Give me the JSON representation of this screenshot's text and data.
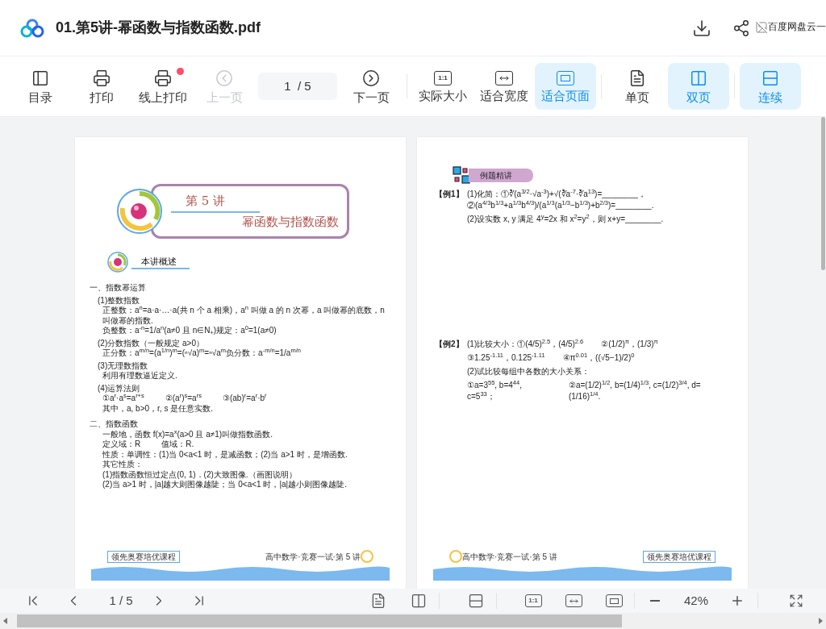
{
  "header": {
    "title": "01.第5讲-幂函数与指数函数.pdf",
    "image_alt": "百度网盘云一"
  },
  "toolbar": [
    [
      {
        "kind": "button",
        "label": "目录",
        "selected": false,
        "disabled": false,
        "notification": false
      },
      {
        "kind": "button",
        "label": "打印",
        "selected": false,
        "disabled": false,
        "notification": false
      },
      {
        "kind": "button",
        "label": "线上打印",
        "selected": false,
        "disabled": false,
        "notification": true
      },
      {
        "kind": "button",
        "label": "上一页",
        "selected": false,
        "disabled": true,
        "notification": false
      },
      {
        "kind": "page_field",
        "value": "1  / 5"
      },
      {
        "kind": "button",
        "label": "下一页",
        "selected": false,
        "disabled": false,
        "notification": false
      }
    ],
    [
      {
        "kind": "button",
        "label": "实际大小",
        "icon_text": "1:1",
        "selected": false,
        "disabled": false,
        "notification": false
      },
      {
        "kind": "button",
        "label": "适合宽度",
        "selected": false,
        "disabled": false,
        "notification": false
      },
      {
        "kind": "button",
        "label": "适合页面",
        "selected": true,
        "disabled": false,
        "notification": false
      }
    ],
    [
      {
        "kind": "button",
        "label": "单页",
        "selected": false,
        "disabled": false,
        "notification": false
      },
      {
        "kind": "button",
        "label": "双页",
        "selected": true,
        "disabled": false,
        "notification": false
      }
    ],
    [
      {
        "kind": "button",
        "label": "连续",
        "selected": true,
        "disabled": false,
        "notification": false
      }
    ]
  ],
  "left_page": {
    "lecture": "第 5 讲",
    "title": "幂函数与指数函数",
    "section": "本讲概述",
    "blocks": [
      {
        "kind": "h1",
        "text": "一、指数幂运算"
      },
      {
        "kind": "sub",
        "text": "(1)整数指数"
      },
      {
        "kind": "p",
        "text": "正整数：a$^{n}$=a·a·…·a(共 n 个 a 相乘)，a$^{n}$ 叫做 a 的 n 次幂，a 叫做幂的底数，n 叫做幂的指数."
      },
      {
        "kind": "p",
        "text": "负整数：a$^{-n}$=1/a$^{n}$(a≠0 且 n∈N$_{+}$)规定：a$^{0}$=1(a≠0)"
      },
      {
        "kind": "sub",
        "text": "(2)分数指数（一般规定 a>0）"
      },
      {
        "kind": "p",
        "text": "正分数：a$^{m/n}$=(a$^{1/n}$)$^{m}$=(ⁿ√a)$^{m}$=ⁿ√a$^{m}$负分数：a$^{-m/n}$=1/a$^{m/n}$"
      },
      {
        "kind": "sub",
        "text": "(3)无理数指数"
      },
      {
        "kind": "p",
        "text": "利用有理数逼近定义."
      },
      {
        "kind": "sub",
        "text": "(4)运算法则"
      },
      {
        "kind": "row",
        "items": [
          "①a$^{r}$·a$^{s}$=a$^{r+s}$",
          "②(a$^{r}$)$^{s}$=a$^{rs}$",
          "③(ab)$^{r}$=a$^{r}$·b$^{r}$"
        ]
      },
      {
        "kind": "p",
        "text": "其中，a, b>0，r, s 是任意实数."
      },
      {
        "kind": "h1",
        "text": "二、指数函数"
      },
      {
        "kind": "p",
        "text": "一般地，函数 f(x)=a$^{x}$(a>0 且 a≠1)叫做指数函数."
      },
      {
        "kind": "row",
        "items": [
          "定义域：R",
          "值域：R."
        ]
      },
      {
        "kind": "p",
        "text": "性质：单调性：(1)当 0<a<1 时，是减函数；(2)当 a>1 时，是增函数."
      },
      {
        "kind": "p",
        "text": "其它性质："
      },
      {
        "kind": "p",
        "text": "(1)指数函数恒过定点(0, 1)．(2)大致图像.（画图说明）"
      },
      {
        "kind": "p",
        "text": "(2)当 a>1 时，|a|越大则图像越陡；当 0<a<1 时，|a|越小则图像越陡."
      }
    ],
    "footer": {
      "brand": "领先奥赛培优课程",
      "course": "高中数学·竞赛一试·第 5 讲"
    }
  },
  "right_page": {
    "section": "例题精讲",
    "examples": [
      {
        "label": "【例1】",
        "lines": [
          [
            "(1)化简：①∛(a$^{3/2}$·√a$^{-3}$)+√(∛a$^{-7}$·∛a$^{13}$)=________，②(a$^{4/3}$b$^{1/3}$+a$^{1/3}$b$^{4/3}$)/(a$^{1/3}$(a$^{1/3}$−b$^{1/3}$)+b$^{2/3}$)=________."
          ],
          [
            "(2)设实数 x, y 满足 4$^{y}$=2x 和 x$^{2}$=y$^{2}$，则 x+y=________."
          ]
        ]
      },
      {
        "label": "【例2】",
        "lines": [
          [
            "(1)比较大小：①(4/5)$^{2.5}$，(4/5)$^{2.6}$",
            "②(1/2)$^{π}$，(1/3)$^{π}$"
          ],
          [
            "③1.25$^{-1.11}$，0.125$^{-1.11}$",
            "④π$^{0.01}$，((√5−1)/2)$^{0}$"
          ],
          [
            "(2)试比较每组中各数的大小关系："
          ],
          [
            "①a=3$^{55}$, b=4$^{44}$, c=5$^{33}$；",
            "②a=(1/2)$^{1/2}$, b=(1/4)$^{1/3}$, c=(1/2)$^{3/4}$, d=(1/16)$^{1/4}$."
          ]
        ]
      }
    ],
    "footer": {
      "course": "高中数学·竞赛一试·第 5 讲",
      "brand": "领先奥赛培优课程"
    }
  },
  "bottom_bar": {
    "page_field": "1 / 5",
    "actual_size": "1:1",
    "zoom": "42%"
  }
}
